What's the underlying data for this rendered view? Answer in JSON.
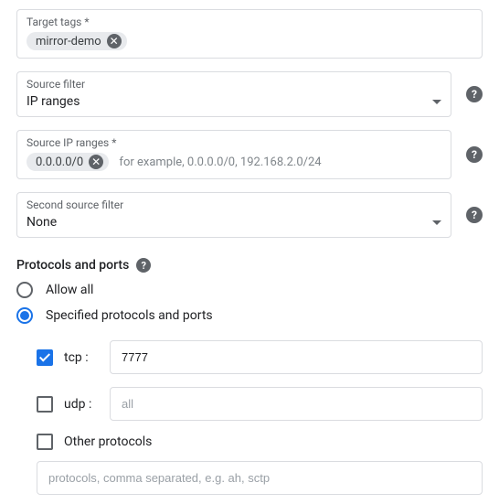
{
  "target_tags": {
    "label": "Target tags *",
    "chips": [
      "mirror-demo"
    ]
  },
  "source_filter": {
    "label": "Source filter",
    "value": "IP ranges"
  },
  "source_ip_ranges": {
    "label": "Source IP ranges *",
    "chips": [
      "0.0.0.0/0"
    ],
    "hint": "for example, 0.0.0.0/0, 192.168.2.0/24"
  },
  "second_source_filter": {
    "label": "Second source filter",
    "value": "None"
  },
  "protocols_section": {
    "title": "Protocols and ports",
    "allow_all_label": "Allow all",
    "specified_label": "Specified protocols and ports",
    "selected": "specified"
  },
  "tcp": {
    "label": "tcp :",
    "checked": true,
    "value": "7777"
  },
  "udp": {
    "label": "udp :",
    "checked": false,
    "placeholder": "all"
  },
  "other": {
    "label": "Other protocols",
    "checked": false,
    "placeholder": "protocols, comma separated, e.g. ah, sctp"
  }
}
